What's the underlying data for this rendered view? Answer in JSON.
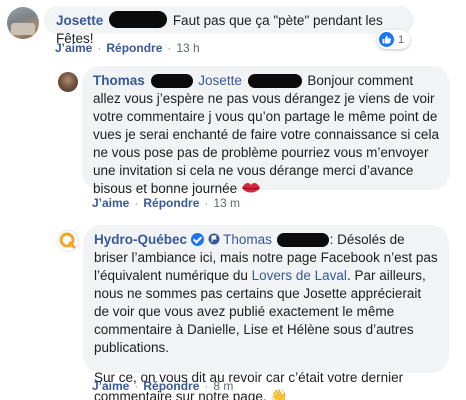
{
  "comments": [
    {
      "author": "Josette",
      "text": "Faut pas que ça \"pète\" pendant les Fêtes!",
      "like_label": "J’aime",
      "reply_label": "Répondre",
      "time": "13 h",
      "reaction_count": "1"
    },
    {
      "author": "Thomas",
      "mention": "Josette",
      "text": "Bonjour comment allez vous j’espère ne pas vous dérangez je viens de voir votre commentaire j vous qu’on partage le même point de vues je serai enchanté de faire votre connaissance si cela ne vous pose pas de problème pourriez vous m’envoyer une invitation si cela ne vous dérange merci d’avance bisous et bonne journée",
      "like_label": "J’aime",
      "reply_label": "Répondre",
      "time": "13 m"
    },
    {
      "author": "Hydro-Québec",
      "mention": "Thomas",
      "text_part1": ": Désolés de briser l’ambiance ici, mais notre page Facebook n’est pas l’équivalent numérique du",
      "link": "Lovers de Laval",
      "text_part2": ". Par ailleurs, nous ne sommes pas certains que Josette apprécierait de voir que vous avez publié exactement le même commentaire à Danielle, Lise et Hélène sous d’autres publications.",
      "paragraph2": "Sur ce, on vous dit au revoir car c’était votre dernier commentaire sur notre page.",
      "like_label": "J’aime",
      "reply_label": "Répondre",
      "time": "8 m"
    }
  ],
  "colors": {
    "link_blue": "#385898",
    "bubble_bg": "#f2f3f5",
    "meta_grey": "#606770",
    "hq_orange": "#f5a623"
  },
  "icons": [
    "like-icon",
    "lips-emoji-icon",
    "verified-badge-icon",
    "page-flag-icon",
    "waving-hand-emoji-icon"
  ]
}
